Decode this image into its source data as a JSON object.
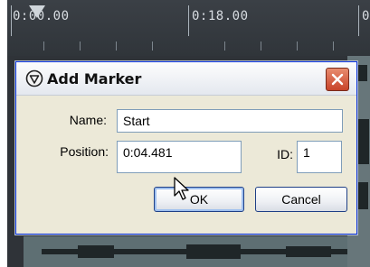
{
  "timeline": {
    "ruler_labels": [
      "0:00.00",
      "0:18.00"
    ]
  },
  "dialog": {
    "title": "Add Marker",
    "name_label": "Name:",
    "name_value": "Start",
    "position_label": "Position:",
    "position_value": "0:04.481",
    "id_label": "ID:",
    "id_value": "1",
    "ok_label": "OK",
    "cancel_label": "Cancel"
  },
  "icons": {
    "title_icon": "reaper-icon",
    "close": "close-icon",
    "cursor": "mouse-pointer-icon",
    "playhead": "playhead-marker-icon"
  },
  "colors": {
    "close_button": "#c8442a",
    "dialog_border": "#0831d9",
    "timeline_bg": "#3a4046"
  }
}
